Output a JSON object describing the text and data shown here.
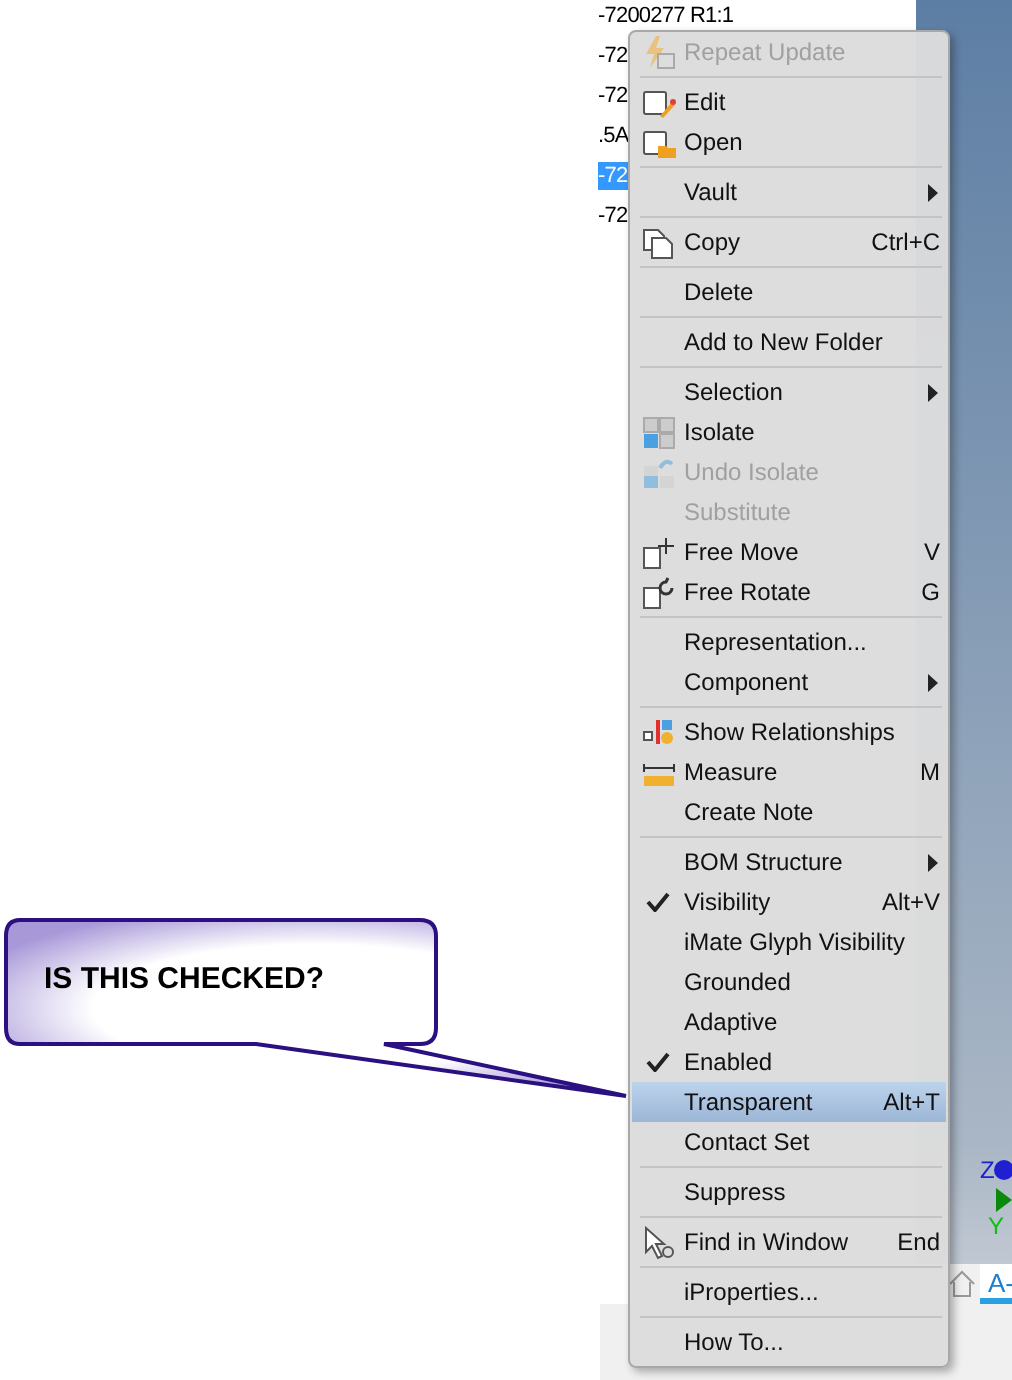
{
  "tree": {
    "rows": [
      {
        "label": "-7200277 R1:1",
        "selected": false
      },
      {
        "label": "-72",
        "selected": false
      },
      {
        "label": "-72",
        "selected": false
      },
      {
        "label": ".5A",
        "selected": false
      },
      {
        "label": "-72",
        "selected": true
      },
      {
        "label": "-72",
        "selected": false
      }
    ]
  },
  "viewport": {
    "axis_labels": [
      {
        "label": "Z",
        "color": "#2020d0"
      },
      {
        "label": "Y",
        "color": "#10c010"
      }
    ],
    "tab": {
      "label": "A-",
      "selected": true
    }
  },
  "menu": {
    "groups": [
      {
        "items": [
          {
            "label": "Repeat Update",
            "kind": "command",
            "disabled": true,
            "checked": false,
            "selected": false
          }
        ]
      },
      {
        "items": [
          {
            "label": "Edit",
            "kind": "command",
            "disabled": false,
            "checked": false,
            "selected": false
          },
          {
            "label": "Open",
            "kind": "command",
            "disabled": false,
            "checked": false,
            "selected": false
          }
        ]
      },
      {
        "items": [
          {
            "label": "Vault",
            "kind": "submenu",
            "disabled": false,
            "checked": false,
            "selected": false
          }
        ]
      },
      {
        "items": [
          {
            "label": "Copy",
            "shortcut": "Ctrl+C",
            "kind": "command",
            "disabled": false,
            "checked": false,
            "selected": false
          }
        ]
      },
      {
        "items": [
          {
            "label": "Delete",
            "kind": "command",
            "disabled": false,
            "checked": false,
            "selected": false
          }
        ]
      },
      {
        "items": [
          {
            "label": "Add to New Folder",
            "kind": "command",
            "disabled": false,
            "checked": false,
            "selected": false
          }
        ]
      },
      {
        "items": [
          {
            "label": "Selection",
            "kind": "submenu",
            "disabled": false,
            "checked": false,
            "selected": false
          },
          {
            "label": "Isolate",
            "kind": "command",
            "disabled": false,
            "checked": false,
            "selected": false
          },
          {
            "label": "Undo Isolate",
            "kind": "command",
            "disabled": true,
            "checked": false,
            "selected": false
          },
          {
            "label": "Substitute",
            "kind": "command",
            "disabled": true,
            "checked": false,
            "selected": false
          },
          {
            "label": "Free Move",
            "shortcut": "V",
            "kind": "command",
            "disabled": false,
            "checked": false,
            "selected": false
          },
          {
            "label": "Free Rotate",
            "shortcut": "G",
            "kind": "command",
            "disabled": false,
            "checked": false,
            "selected": false
          }
        ]
      },
      {
        "items": [
          {
            "label": "Representation...",
            "kind": "command",
            "disabled": false,
            "checked": false,
            "selected": false
          },
          {
            "label": "Component",
            "kind": "submenu",
            "disabled": false,
            "checked": false,
            "selected": false
          }
        ]
      },
      {
        "items": [
          {
            "label": "Show Relationships",
            "kind": "command",
            "disabled": false,
            "checked": false,
            "selected": false
          },
          {
            "label": "Measure",
            "shortcut": "M",
            "kind": "command",
            "disabled": false,
            "checked": false,
            "selected": false
          },
          {
            "label": "Create Note",
            "kind": "command",
            "disabled": false,
            "checked": false,
            "selected": false
          }
        ]
      },
      {
        "items": [
          {
            "label": "BOM Structure",
            "kind": "submenu",
            "disabled": false,
            "checked": false,
            "selected": false
          },
          {
            "label": "Visibility",
            "shortcut": "Alt+V",
            "kind": "command",
            "disabled": false,
            "checked": true,
            "selected": false
          },
          {
            "label": "iMate Glyph Visibility",
            "kind": "command",
            "disabled": false,
            "checked": false,
            "selected": false
          },
          {
            "label": "Grounded",
            "kind": "command",
            "disabled": false,
            "checked": false,
            "selected": false
          },
          {
            "label": "Adaptive",
            "kind": "command",
            "disabled": false,
            "checked": false,
            "selected": false
          },
          {
            "label": "Enabled",
            "kind": "command",
            "disabled": false,
            "checked": true,
            "selected": false
          },
          {
            "label": "Transparent",
            "shortcut": "Alt+T",
            "kind": "command",
            "disabled": false,
            "checked": false,
            "selected": true
          },
          {
            "label": "Contact Set",
            "kind": "command",
            "disabled": false,
            "checked": false,
            "selected": false
          }
        ]
      },
      {
        "items": [
          {
            "label": "Suppress",
            "kind": "command",
            "disabled": false,
            "checked": false,
            "selected": false
          }
        ]
      },
      {
        "items": [
          {
            "label": "Find in Window",
            "shortcut": "End",
            "kind": "command",
            "disabled": false,
            "checked": false,
            "selected": false
          }
        ]
      },
      {
        "items": [
          {
            "label": "iProperties...",
            "kind": "command",
            "disabled": false,
            "checked": false,
            "selected": false
          }
        ]
      },
      {
        "items": [
          {
            "label": "How To...",
            "kind": "command",
            "disabled": false,
            "checked": false,
            "selected": false
          }
        ]
      }
    ]
  },
  "callout": {
    "text": "IS THIS CHECKED?"
  }
}
